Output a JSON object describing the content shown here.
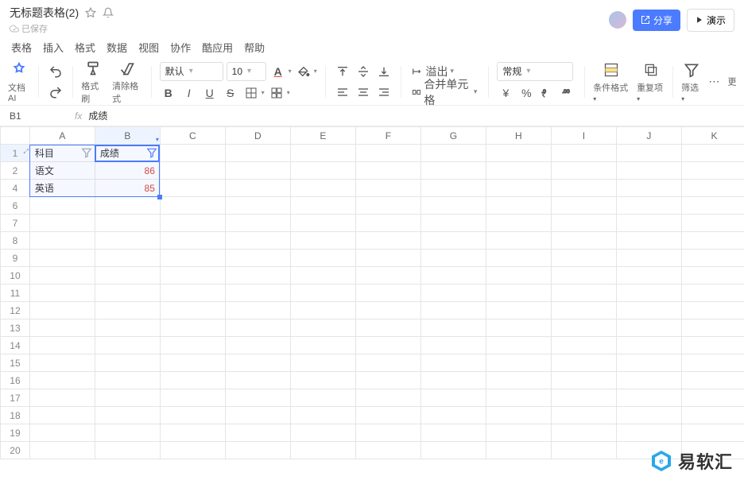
{
  "title": "无标题表格(2)",
  "saved_status": "已保存",
  "share_button": "分享",
  "present_button": "演示",
  "menu": [
    "表格",
    "插入",
    "格式",
    "数据",
    "视图",
    "协作",
    "酷应用",
    "帮助"
  ],
  "toolbar": {
    "doc_ai": "文档AI",
    "format_painter": "格式刷",
    "clear_format": "清除格式",
    "font_family": "默认",
    "font_size": "10",
    "overflow": "溢出",
    "merge_cells": "合并单元格",
    "number_format": "常规",
    "cond_format": "条件格式",
    "duplicates": "重复项",
    "filter": "筛选",
    "more": "更"
  },
  "namebox": "B1",
  "formula": "成绩",
  "columns": [
    "A",
    "B",
    "C",
    "D",
    "E",
    "F",
    "G",
    "H",
    "I",
    "J",
    "K"
  ],
  "visible_rows": [
    1,
    2,
    4,
    6,
    7,
    8,
    9,
    10,
    11,
    12,
    13,
    14,
    15,
    16,
    17,
    18,
    19,
    20
  ],
  "selected_col_index": 1,
  "cells": {
    "A1": "科目",
    "B1": "成绩",
    "A2": "语文",
    "B2": "86",
    "A4": "英语",
    "B4": "85"
  },
  "chart_data": {
    "type": "table",
    "columns": [
      "科目",
      "成绩"
    ],
    "rows": [
      {
        "科目": "语文",
        "成绩": 86
      },
      {
        "科目": "英语",
        "成绩": 85
      }
    ]
  },
  "watermark": "易软汇"
}
